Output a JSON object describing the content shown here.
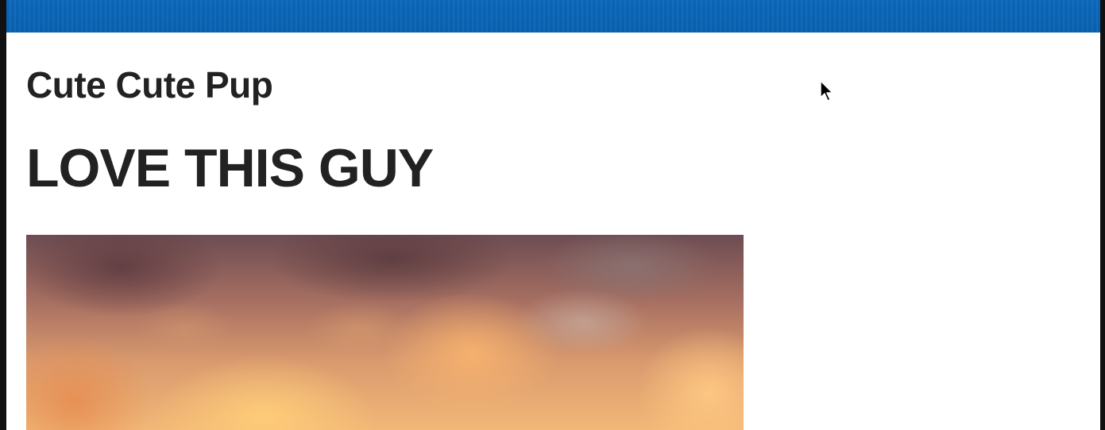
{
  "header": {
    "bar_color": "#0a63b3"
  },
  "site": {
    "title": "Cute Cute Pup"
  },
  "post": {
    "title": "LOVE THIS GUY"
  },
  "hero": {
    "image": "sunset-clouds"
  },
  "icons": {
    "cursor": "mouse-pointer-icon"
  }
}
